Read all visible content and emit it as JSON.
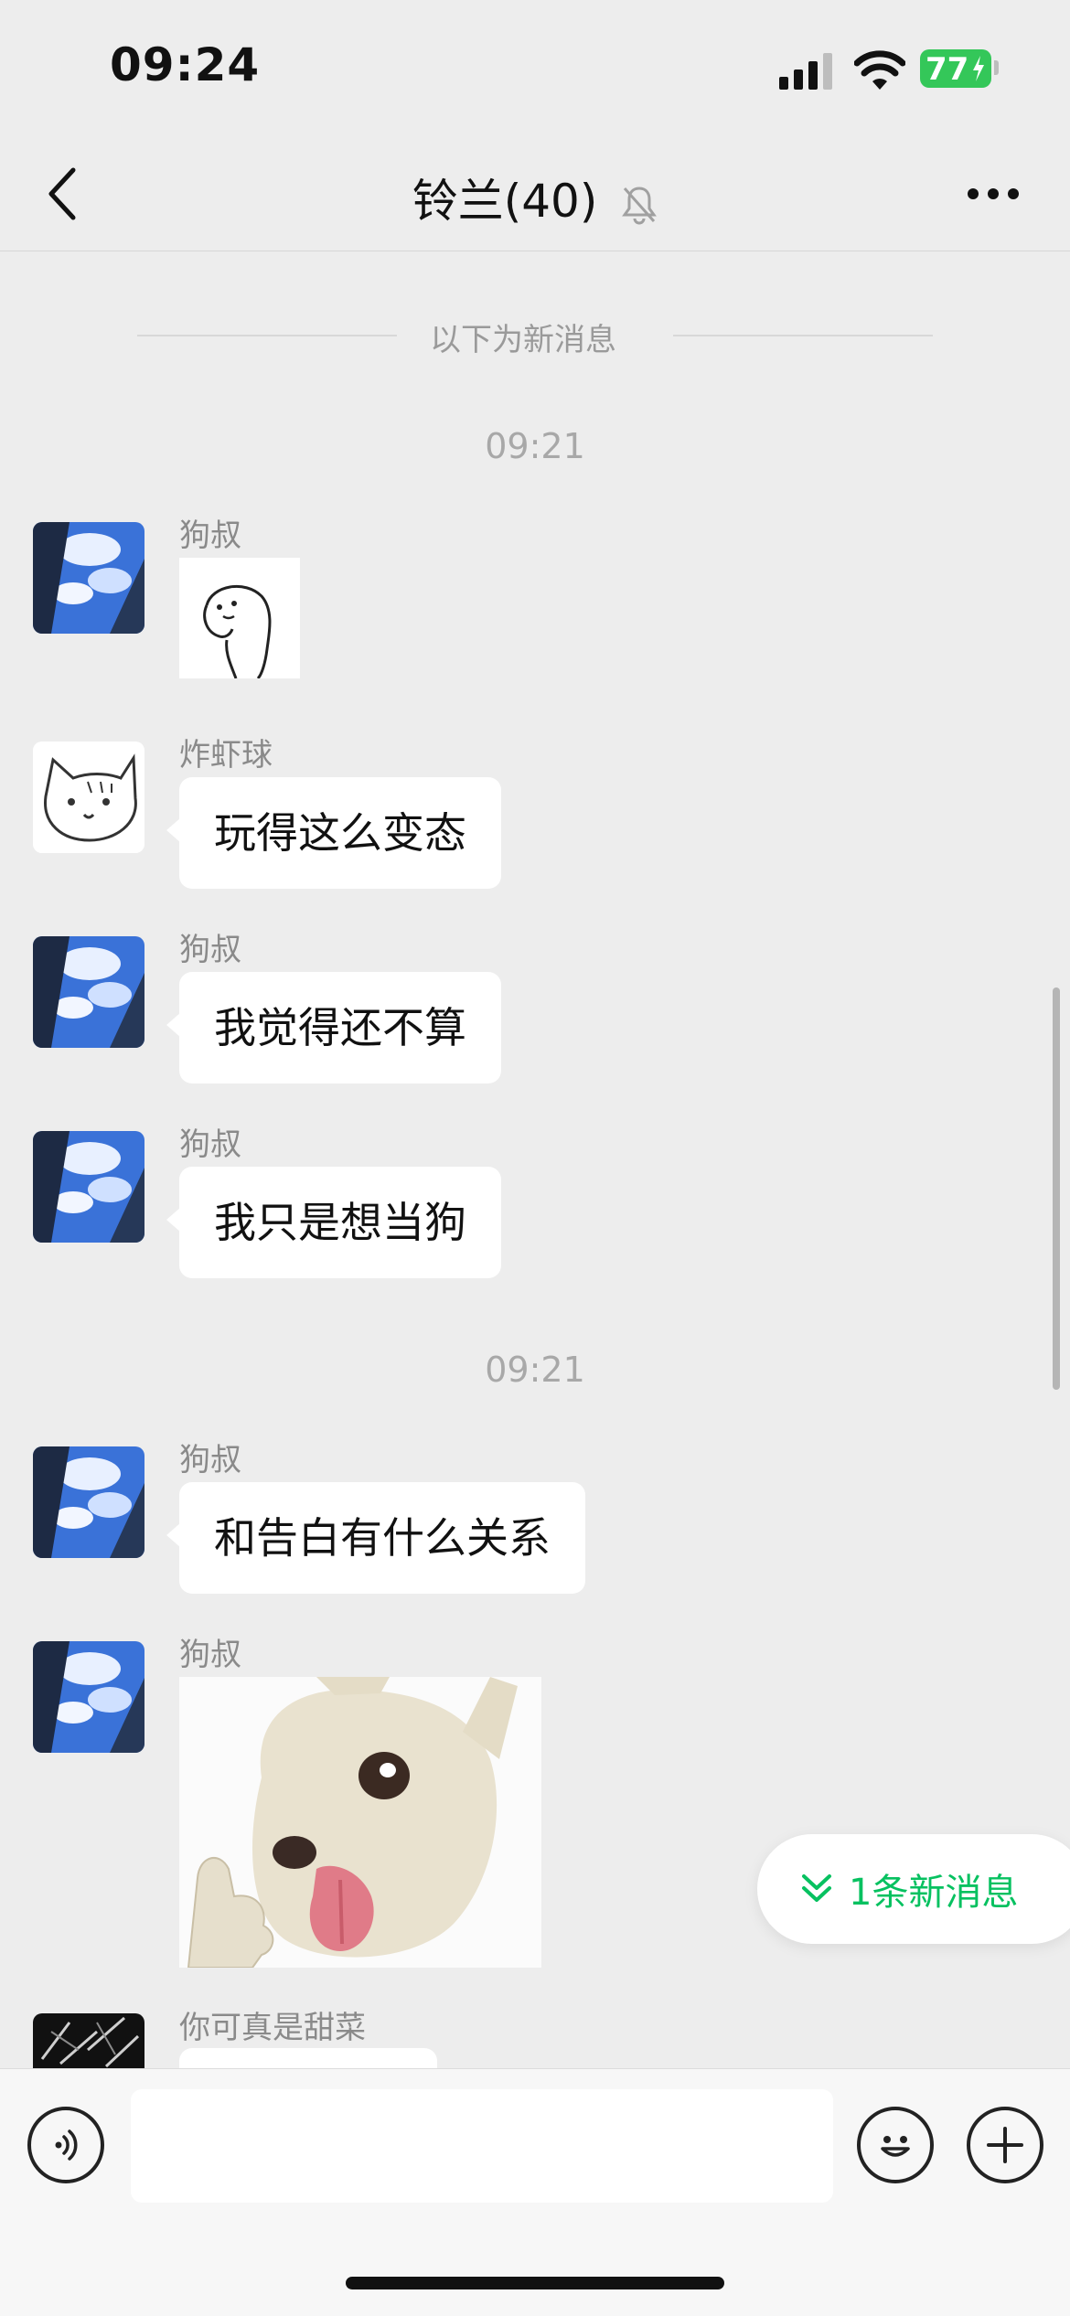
{
  "status_bar": {
    "time": "09:24",
    "battery": "77"
  },
  "header": {
    "title": "铃兰(40)"
  },
  "chat": {
    "new_messages_divider": "以下为新消息",
    "timestamps": [
      "09:21",
      "09:21"
    ],
    "messages": [
      {
        "sender": "狗叔",
        "type": "sticker",
        "sticker": "line-drawn-blob-sticker"
      },
      {
        "sender": "炸虾球",
        "type": "text",
        "text": "玩得这么变态"
      },
      {
        "sender": "狗叔",
        "type": "text",
        "text": "我觉得还不算"
      },
      {
        "sender": "狗叔",
        "type": "text",
        "text": "我只是想当狗"
      },
      {
        "sender": "狗叔",
        "type": "text",
        "text": "和告白有什么关系"
      },
      {
        "sender": "狗叔",
        "type": "sticker",
        "sticker": "chihuahua-tongue-thumbs-up-sticker"
      },
      {
        "sender": "你可真是甜菜",
        "type": "text",
        "text": ""
      }
    ]
  },
  "new_message_button": {
    "label": "1条新消息"
  },
  "input_bar": {
    "placeholder": ""
  },
  "colors": {
    "accent": "#07c160",
    "background": "#ededed",
    "bubble": "#ffffff",
    "battery": "#34c759"
  }
}
